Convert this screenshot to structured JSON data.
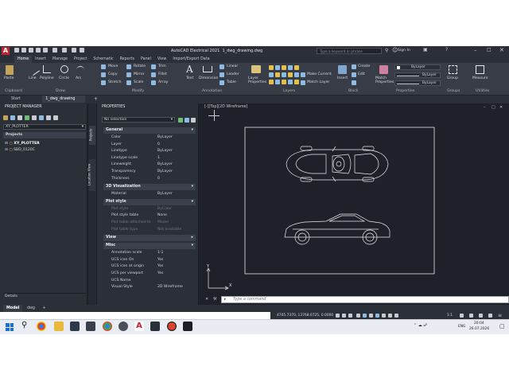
{
  "app": {
    "title": "AutoCAD Electrical 2021",
    "file": "1_dwg_drawing.dwg",
    "search_placeholder": "Type a keyword or phrase",
    "sign_in": "Sign In"
  },
  "ribbon_tabs": [
    "Home",
    "Insert",
    "Manage",
    "Project",
    "Schematic",
    "Reports",
    "Panel",
    "View",
    "Import/Export Data"
  ],
  "ribbon": {
    "clipboard": {
      "label": "Clipboard",
      "paste": "Paste"
    },
    "draw": {
      "label": "Draw",
      "tools": [
        "Line",
        "Polyline",
        "Circle",
        "Arc"
      ]
    },
    "modify": {
      "label": "Modify",
      "tools": [
        "Move",
        "Rotate",
        "Trim",
        "Copy",
        "Mirror",
        "Fillet",
        "Stretch",
        "Scale",
        "Array"
      ]
    },
    "annotation": {
      "label": "Annotation",
      "text": "Text",
      "dimension": "Dimension",
      "linear": "Linear",
      "leader": "Leader",
      "table": "Table"
    },
    "layers": {
      "label": "Layers",
      "layer_properties": "Layer Properties",
      "make_current": "Make Current",
      "match_layer": "Match Layer"
    },
    "block": {
      "label": "Block",
      "insert": "Insert",
      "create": "Create",
      "edit": "Edit",
      "edit_attributes": "Edit Attributes"
    },
    "properties": {
      "label": "Properties",
      "match_properties": "Match Properties",
      "bylayer_1": "ByLayer",
      "bylayer_2": "ByLayer",
      "bylayer_3": "ByLayer"
    },
    "groups": {
      "label": "Groups",
      "group": "Group"
    },
    "utilities": {
      "label": "Utilities",
      "measure": "Measure"
    }
  },
  "doc_tabs": [
    "Start",
    "1_dwg_drawing"
  ],
  "project_manager": {
    "title": "PROJECT MANAGER",
    "active_project": "XY_PLOTTER",
    "projects_label": "Projects",
    "projects": [
      "XY_PLOTTER",
      "SBD_0120C"
    ],
    "details": "Details"
  },
  "side_tabs": {
    "projects": "Projects",
    "location": "Location View"
  },
  "properties": {
    "title": "PROPERTIES",
    "selection": "No selection",
    "sections": [
      {
        "name": "General",
        "rows": [
          {
            "k": "Color",
            "v": "ByLayer"
          },
          {
            "k": "Layer",
            "v": "0"
          },
          {
            "k": "Linetype",
            "v": "ByLayer"
          },
          {
            "k": "Linetype scale",
            "v": "1"
          },
          {
            "k": "Lineweight",
            "v": "ByLayer"
          },
          {
            "k": "Transparency",
            "v": "ByLayer"
          },
          {
            "k": "Thickness",
            "v": "0"
          }
        ]
      },
      {
        "name": "3D Visualization",
        "rows": [
          {
            "k": "Material",
            "v": "ByLayer"
          }
        ]
      },
      {
        "name": "Plot style",
        "rows": [
          {
            "k": "Plot style",
            "v": "ByColor",
            "disabled": true
          },
          {
            "k": "Plot style table",
            "v": "None"
          },
          {
            "k": "Plot table attached to",
            "v": "Model",
            "disabled": true
          },
          {
            "k": "Plot table type",
            "v": "Not available",
            "disabled": true
          }
        ]
      },
      {
        "name": "View",
        "rows": []
      },
      {
        "name": "Misc",
        "rows": [
          {
            "k": "Annotation scale",
            "v": "1:1"
          },
          {
            "k": "UCS icon On",
            "v": "Yes"
          },
          {
            "k": "UCS icon at origin",
            "v": "Yes"
          },
          {
            "k": "UCS per viewport",
            "v": "Yes"
          },
          {
            "k": "UCS Name",
            "v": ""
          },
          {
            "k": "Visual Style",
            "v": "2D Wireframe"
          }
        ]
      }
    ]
  },
  "viewport": {
    "label": "[-][Top][2D Wireframe]"
  },
  "command": {
    "placeholder": "Type a command"
  },
  "model_tabs": [
    "Model",
    "dwg"
  ],
  "status": {
    "coords": "4705.7370, 13768.0725, 0.0000",
    "scale": "1:1"
  },
  "clock": {
    "time": "20:04",
    "date": "26.07.2026",
    "lang": "ENG"
  }
}
